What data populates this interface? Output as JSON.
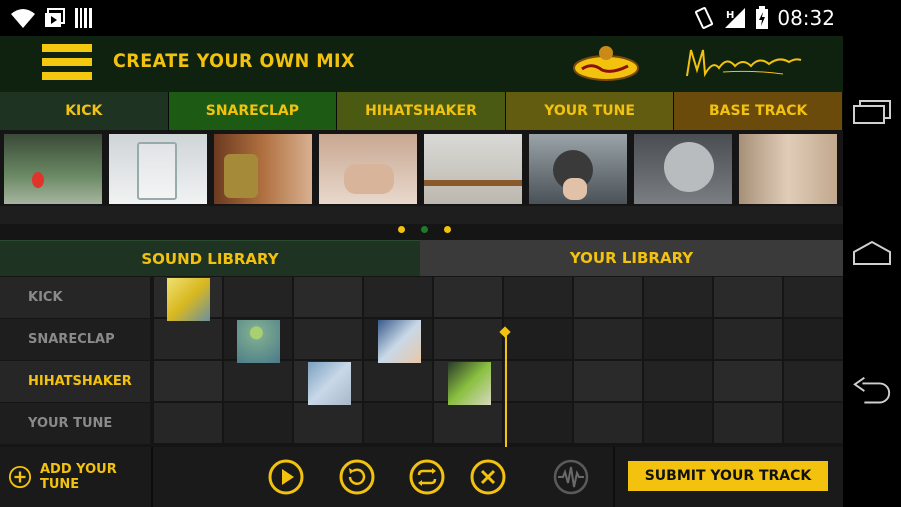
{
  "statusbar": {
    "clock": "08:32",
    "network": "H"
  },
  "app": {
    "title": "CREATE YOUR OWN MIX",
    "colors": {
      "accent": "#f2c20f",
      "header": "#0f2210"
    },
    "category_tabs": [
      {
        "label": "KICK",
        "bg": "#1f3323"
      },
      {
        "label": "SNARECLAP",
        "bg": "#1d5a14"
      },
      {
        "label": "HIHATSHAKER",
        "bg": "#4b5a12"
      },
      {
        "label": "YOUR TUNE",
        "bg": "#625c10"
      },
      {
        "label": "BASE TRACK",
        "bg": "#6a4b0c"
      }
    ],
    "library_tabs": {
      "sound": "SOUND LIBRARY",
      "yours": "YOUR LIBRARY"
    },
    "tracks": [
      {
        "label": "KICK",
        "active": false
      },
      {
        "label": "SNARECLAP",
        "active": false
      },
      {
        "label": "HIHATSHAKER",
        "active": true
      },
      {
        "label": "YOUR TUNE",
        "active": false
      }
    ],
    "add_tune_label": "ADD YOUR TUNE",
    "submit_label": "SUBMIT YOUR TRACK",
    "controls": [
      "play-icon",
      "undo-icon",
      "loop-icon",
      "clear-icon",
      "waveform-icon"
    ]
  }
}
